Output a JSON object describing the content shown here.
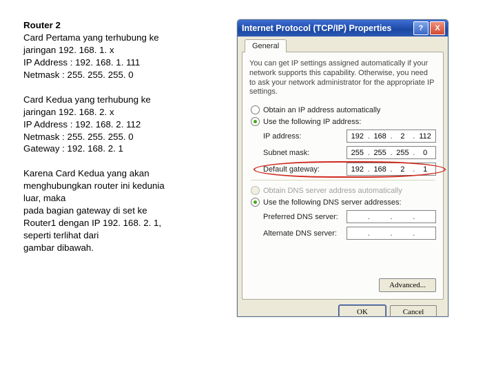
{
  "left": {
    "para1_title": "Router 2",
    "para1_l1": "Card Pertama yang terhubung ke",
    "para1_l2": "jaringan 192. 168. 1. x",
    "para1_l3": "IP Address : 192. 168. 1. 111",
    "para1_l4": "Netmask : 255. 255. 255. 0",
    "para2_l1": "Card Kedua yang terhubung ke",
    "para2_l2": "jaringan 192. 168. 2. x",
    "para2_l3": "IP Address : 192. 168. 2. 112",
    "para2_l4": "Netmask : 255. 255. 255. 0",
    "para2_l5": "Gateway : 192. 168. 2. 1",
    "para3_l1": "Karena Card Kedua yang akan",
    "para3_l2": "menghubungkan router ini kedunia",
    "para3_l3": "luar, maka",
    "para3_l4": "pada bagian gateway di set ke",
    "para3_l5": "Router1 dengan IP 192. 168. 2. 1,",
    "para3_l6": "seperti terlihat dari",
    "para3_l7": "gambar dibawah."
  },
  "win": {
    "title": "Internet Protocol (TCP/IP) Properties",
    "help": "?",
    "close": "X",
    "tab": "General",
    "desc": "You can get IP settings assigned automatically if your network supports this capability. Otherwise, you need to ask your network administrator for the appropriate IP settings.",
    "radio_auto_ip": "Obtain an IP address automatically",
    "radio_man_ip": "Use the following IP address:",
    "radio_auto_dns": "Obtain DNS server address automatically",
    "radio_man_dns": "Use the following DNS server addresses:",
    "lbl_ip": "IP address:",
    "lbl_subnet": "Subnet mask:",
    "lbl_gateway": "Default gateway:",
    "lbl_dns1": "Preferred DNS server:",
    "lbl_dns2": "Alternate DNS server:",
    "ip": {
      "a": "192",
      "b": "168",
      "c": "2",
      "d": "112"
    },
    "mask": {
      "a": "255",
      "b": "255",
      "c": "255",
      "d": "0"
    },
    "gateway": {
      "a": "192",
      "b": "168",
      "c": "2",
      "d": "1"
    },
    "advanced": "Advanced...",
    "ok": "OK",
    "cancel": "Cancel"
  }
}
